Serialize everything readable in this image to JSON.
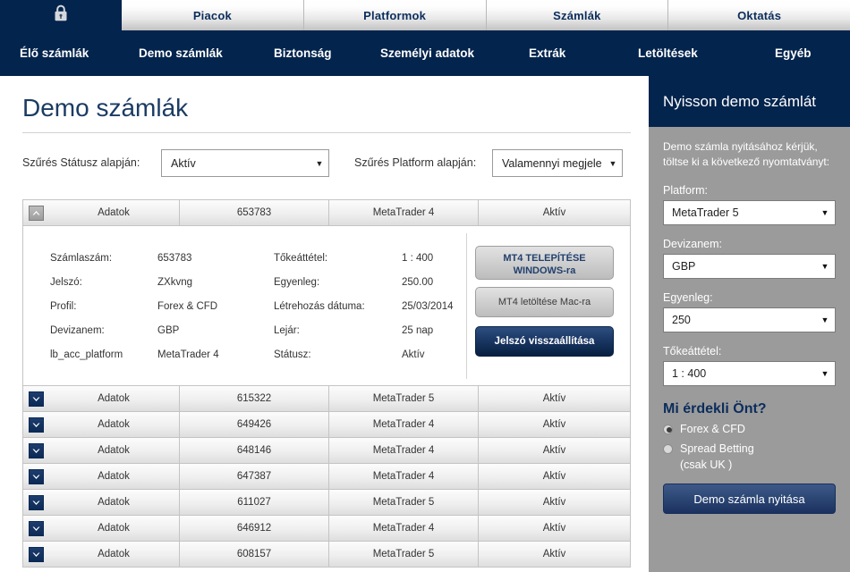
{
  "topnav": {
    "lock_icon": "lock-icon",
    "tabs": [
      {
        "label": "Piacok"
      },
      {
        "label": "Platformok"
      },
      {
        "label": "Számlák"
      },
      {
        "label": "Oktatás"
      }
    ]
  },
  "subnav": {
    "items": [
      {
        "label": "Élő számlák"
      },
      {
        "label": "Demo számlák"
      },
      {
        "label": "Biztonság"
      },
      {
        "label": "Személyi adatok"
      },
      {
        "label": "Extrák"
      },
      {
        "label": "Letöltések"
      },
      {
        "label": "Egyéb"
      }
    ]
  },
  "main": {
    "page_title": "Demo számlák",
    "filters": {
      "status_label": "Szűrés Státusz alapján:",
      "status_value": "Aktív",
      "platform_label": "Szűrés Platform alapján:",
      "platform_value": "Valamennyi megjele"
    },
    "table": {
      "expanded_row": {
        "toggle_icon": "chevron-up-icon",
        "data_label": "Adatok",
        "account": "653783",
        "platform": "MetaTrader 4",
        "status": "Aktív"
      },
      "detail": {
        "left": [
          {
            "key": "Számlaszám:",
            "value": "653783"
          },
          {
            "key": "Jelszó:",
            "value": "ZXkvng"
          },
          {
            "key": "Profil:",
            "value": "Forex & CFD"
          },
          {
            "key": "Devizanem:",
            "value": "GBP"
          },
          {
            "key": "lb_acc_platform",
            "value": "MetaTrader 4"
          }
        ],
        "right": [
          {
            "key": "Tőkeáttétel:",
            "value": "1 : 400"
          },
          {
            "key": "Egyenleg:",
            "value": "250.00"
          },
          {
            "key": "Létrehozás dátuma:",
            "value": "25/03/2014"
          },
          {
            "key": "Lejár:",
            "value": "25 nap"
          },
          {
            "key": "Státusz:",
            "value": "Aktív"
          }
        ],
        "buttons": {
          "install_windows_line1": "MT4 TELEPÍTÉSE",
          "install_windows_line2": "WINDOWS-ra",
          "download_mac": "MT4 letöltése Mac-ra",
          "reset_password": "Jelszó visszaállítása"
        }
      },
      "rows": [
        {
          "toggle_icon": "chevron-down-icon",
          "data_label": "Adatok",
          "account": "615322",
          "platform": "MetaTrader 5",
          "status": "Aktív"
        },
        {
          "toggle_icon": "chevron-down-icon",
          "data_label": "Adatok",
          "account": "649426",
          "platform": "MetaTrader 4",
          "status": "Aktív"
        },
        {
          "toggle_icon": "chevron-down-icon",
          "data_label": "Adatok",
          "account": "648146",
          "platform": "MetaTrader 4",
          "status": "Aktív"
        },
        {
          "toggle_icon": "chevron-down-icon",
          "data_label": "Adatok",
          "account": "647387",
          "platform": "MetaTrader 4",
          "status": "Aktív"
        },
        {
          "toggle_icon": "chevron-down-icon",
          "data_label": "Adatok",
          "account": "611027",
          "platform": "MetaTrader 5",
          "status": "Aktív"
        },
        {
          "toggle_icon": "chevron-down-icon",
          "data_label": "Adatok",
          "account": "646912",
          "platform": "MetaTrader 4",
          "status": "Aktív"
        },
        {
          "toggle_icon": "chevron-down-icon",
          "data_label": "Adatok",
          "account": "608157",
          "platform": "MetaTrader 5",
          "status": "Aktív"
        }
      ]
    }
  },
  "sidebar": {
    "title": "Nyisson demo számlát",
    "intro": "Demo számla nyitásához kérjük, töltse ki a következő nyomtatványt:",
    "fields": [
      {
        "label": "Platform:",
        "value": "MetaTrader 5"
      },
      {
        "label": "Devizanem:",
        "value": "GBP"
      },
      {
        "label": "Egyenleg:",
        "value": "250"
      },
      {
        "label": "Tőkeáttétel:",
        "value": "1 : 400"
      }
    ],
    "interest_heading": "Mi érdekli Önt?",
    "radios": [
      {
        "label": "Forex & CFD",
        "selected": true
      },
      {
        "label": "Spread Betting",
        "selected": false
      }
    ],
    "radio_note": "(csak UK )",
    "cta": "Demo számla nyitása"
  },
  "colors": {
    "navy": "#03244d",
    "title_blue": "#1b3b63",
    "sidebar_gray": "#9b9b9b",
    "accent_button": "#2c4674"
  }
}
